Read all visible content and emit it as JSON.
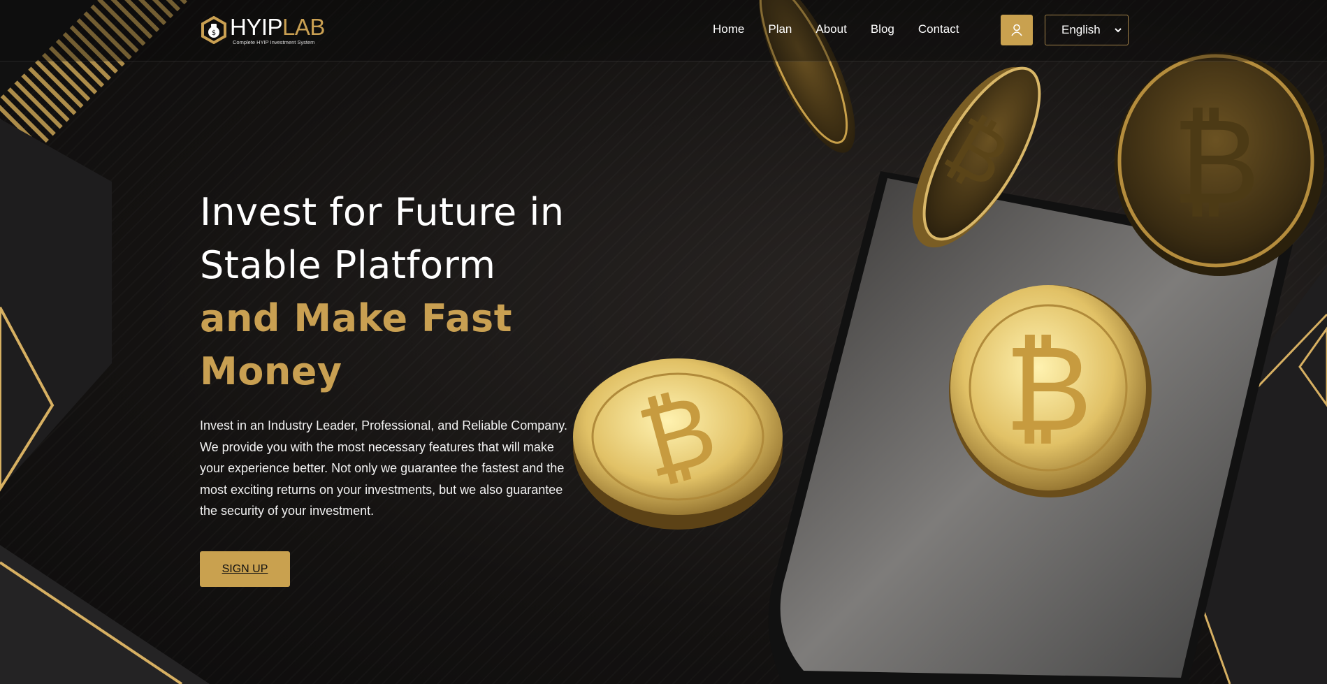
{
  "header": {
    "logo": {
      "name_white": "HYIP",
      "name_gold": "LAB",
      "tagline": "Complete HYIP Investment System"
    },
    "nav": [
      "Home",
      "Plan",
      "About",
      "Blog",
      "Contact"
    ],
    "user_icon": "user-icon",
    "language": {
      "selected": "English"
    }
  },
  "hero": {
    "title_line1": "Invest for Future in",
    "title_line2": "Stable Platform",
    "title_line3": "and Make Fast",
    "title_line4": "Money",
    "description": "Invest in an Industry Leader, Professional, and Reliable Company. We provide you with the most necessary features that will make your experience better. Not only we guarantee the fastest and the most exciting returns on your investments, but we also guarantee the security of your investment.",
    "signup_label": "SIGN UP"
  },
  "colors": {
    "accent": "#c9a14f",
    "background": "#151312",
    "text": "#ffffff"
  }
}
